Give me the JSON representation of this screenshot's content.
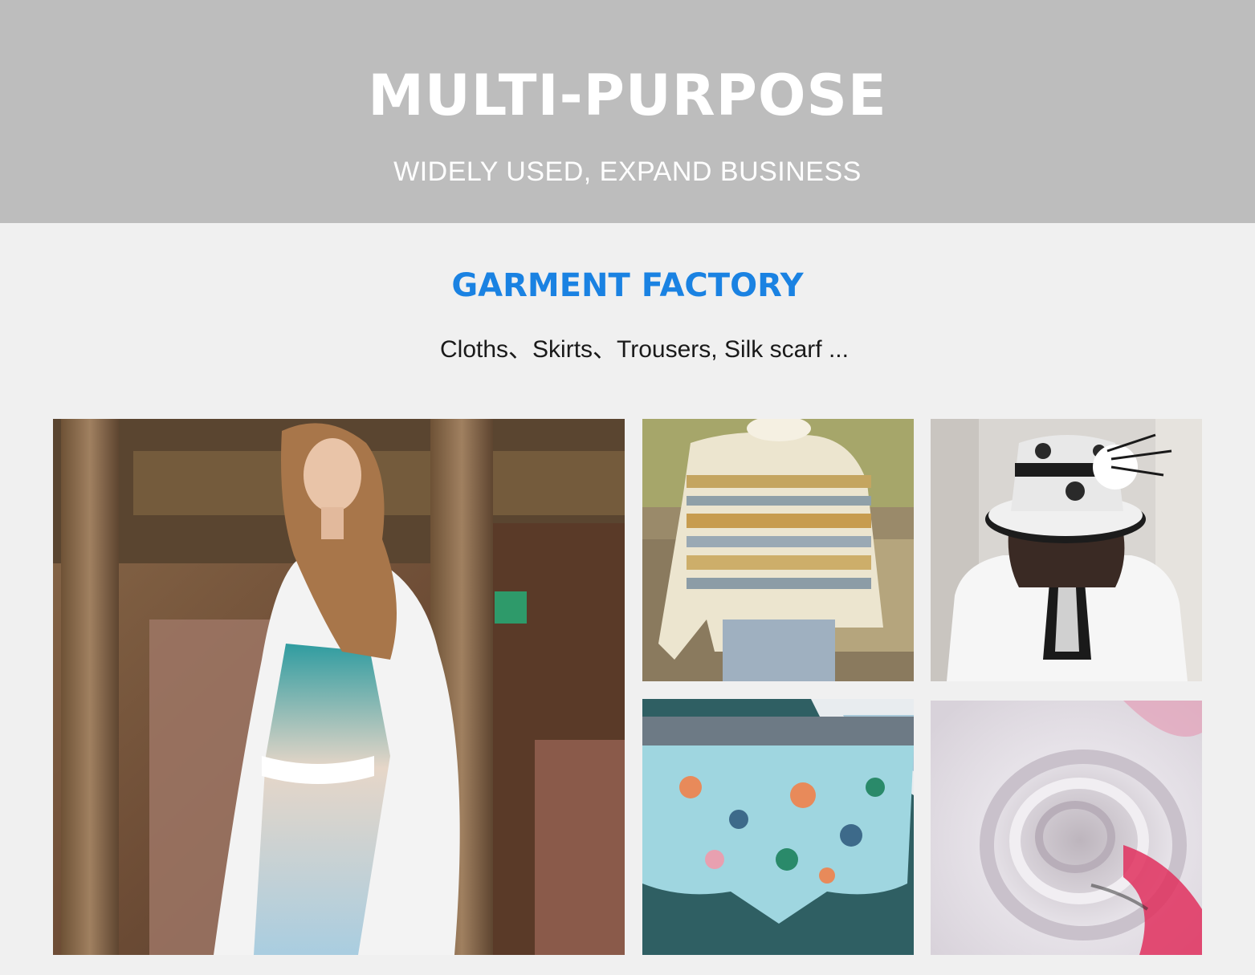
{
  "banner": {
    "title": "MULTI-PURPOSE",
    "subtitle": "WIDELY USED, EXPAND BUSINESS"
  },
  "section": {
    "title": "GARMENT FACTORY",
    "description": "Cloths、Skirts、Trousers, Silk scarf ..."
  },
  "colors": {
    "banner_background": "#bdbdbd",
    "page_background": "#f0f0f0",
    "accent": "#1a82e2"
  }
}
